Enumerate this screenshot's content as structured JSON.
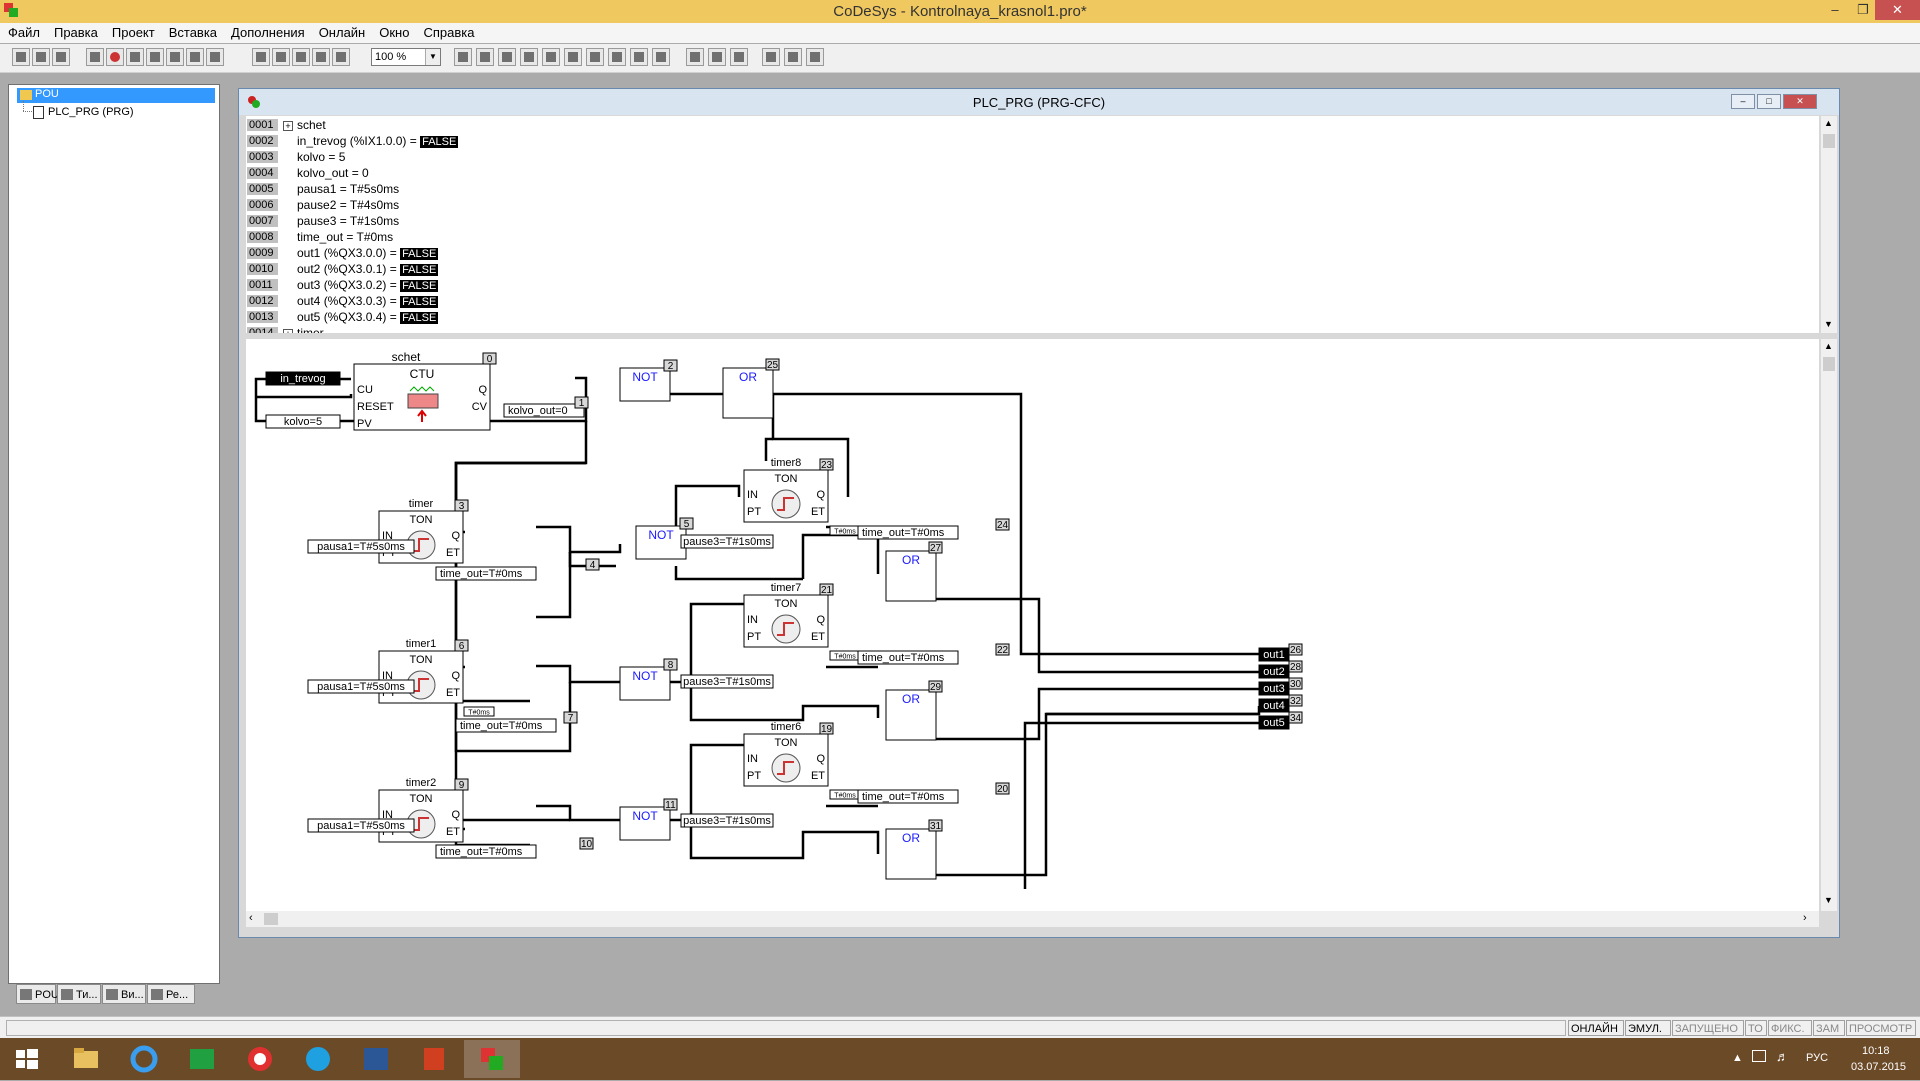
{
  "window": {
    "title": "CoDeSys - Kontrolnaya_krasnol1.pro*"
  },
  "menu": [
    "Файл",
    "Правка",
    "Проект",
    "Вставка",
    "Дополнения",
    "Онлайн",
    "Окно",
    "Справка"
  ],
  "toolbar": {
    "zoom": "100 %"
  },
  "tree": {
    "root": "POU",
    "child": "PLC_PRG (PRG)"
  },
  "left_tabs": [
    "POU",
    "Ти...",
    "Ви...",
    "Ре..."
  ],
  "editor": {
    "title": "PLC_PRG (PRG-CFC)"
  },
  "declarations": [
    {
      "no": "0001",
      "text": "schet",
      "badge": "",
      "expand": true
    },
    {
      "no": "0002",
      "text": "in_trevog (%IX1.0.0) = ",
      "badge": "FALSE",
      "expand": false
    },
    {
      "no": "0003",
      "text": "kolvo = 5",
      "badge": "",
      "expand": false
    },
    {
      "no": "0004",
      "text": "kolvo_out = 0",
      "badge": "",
      "expand": false
    },
    {
      "no": "0005",
      "text": "pausa1 = T#5s0ms",
      "badge": "",
      "expand": false
    },
    {
      "no": "0006",
      "text": "pause2 = T#4s0ms",
      "badge": "",
      "expand": false
    },
    {
      "no": "0007",
      "text": "pause3 = T#1s0ms",
      "badge": "",
      "expand": false
    },
    {
      "no": "0008",
      "text": "time_out = T#0ms",
      "badge": "",
      "expand": false
    },
    {
      "no": "0009",
      "text": "out1 (%QX3.0.0) = ",
      "badge": "FALSE",
      "expand": false
    },
    {
      "no": "0010",
      "text": "out2 (%QX3.0.1) = ",
      "badge": "FALSE",
      "expand": false
    },
    {
      "no": "0011",
      "text": "out3 (%QX3.0.2) = ",
      "badge": "FALSE",
      "expand": false
    },
    {
      "no": "0012",
      "text": "out4 (%QX3.0.3) = ",
      "badge": "FALSE",
      "expand": false
    },
    {
      "no": "0013",
      "text": "out5 (%QX3.0.4) = ",
      "badge": "FALSE",
      "expand": false
    },
    {
      "no": "0014",
      "text": "timer",
      "badge": "",
      "expand": true
    }
  ],
  "cfc": {
    "inputs": {
      "in_trevog": "in_trevog",
      "kolvo": "kolvo=5",
      "pausa1": "pausa1=T#5s0ms",
      "pause3": "pause3=T#1s0ms"
    },
    "outputs": {
      "kolvo_out": "kolvo_out=0",
      "time_out": "time_out=T#0ms",
      "et_small": "T#0ms"
    },
    "ctu": {
      "name": "schet",
      "type": "CTU",
      "pins_in": [
        "CU",
        "RESET",
        "PV"
      ],
      "pins_out": [
        "Q",
        "CV"
      ],
      "id": "0"
    },
    "ton_type": "TON",
    "ton_pins_in": [
      "IN",
      "PT"
    ],
    "ton_pins_out": [
      "Q",
      "ET"
    ],
    "timers": {
      "timer": "timer",
      "timer1": "timer1",
      "timer2": "timer2",
      "timer6": "timer6",
      "timer7": "timer7",
      "timer8": "timer8"
    },
    "ops": {
      "not": "NOT",
      "or": "OR"
    },
    "out_labels": [
      "out1",
      "out2",
      "out3",
      "out4",
      "out5"
    ],
    "ids": {
      "n0": "0",
      "n1": "1",
      "n2": "2",
      "n3": "3",
      "n4": "4",
      "n5": "5",
      "n6": "6",
      "n7": "7",
      "n8": "8",
      "n9": "9",
      "n10": "10",
      "n11": "11",
      "n19": "19",
      "n20": "20",
      "n21": "21",
      "n22": "22",
      "n23": "23",
      "n24": "24",
      "n25": "25",
      "n26": "26",
      "n27": "27",
      "n28": "28",
      "n29": "29",
      "n30": "30",
      "n31": "31",
      "n32": "32",
      "n34": "34"
    }
  },
  "status": {
    "online": "ОНЛАЙН",
    "emul": "ЭМУЛ.",
    "started": "ЗАПУЩЕНО",
    "to": "ТО",
    "fix": "ФИКС.",
    "zam": "ЗАМ",
    "view": "ПРОСМОТР"
  },
  "taskbar": {
    "lang": "РУС",
    "time": "10:18",
    "date": "03.07.2015"
  }
}
